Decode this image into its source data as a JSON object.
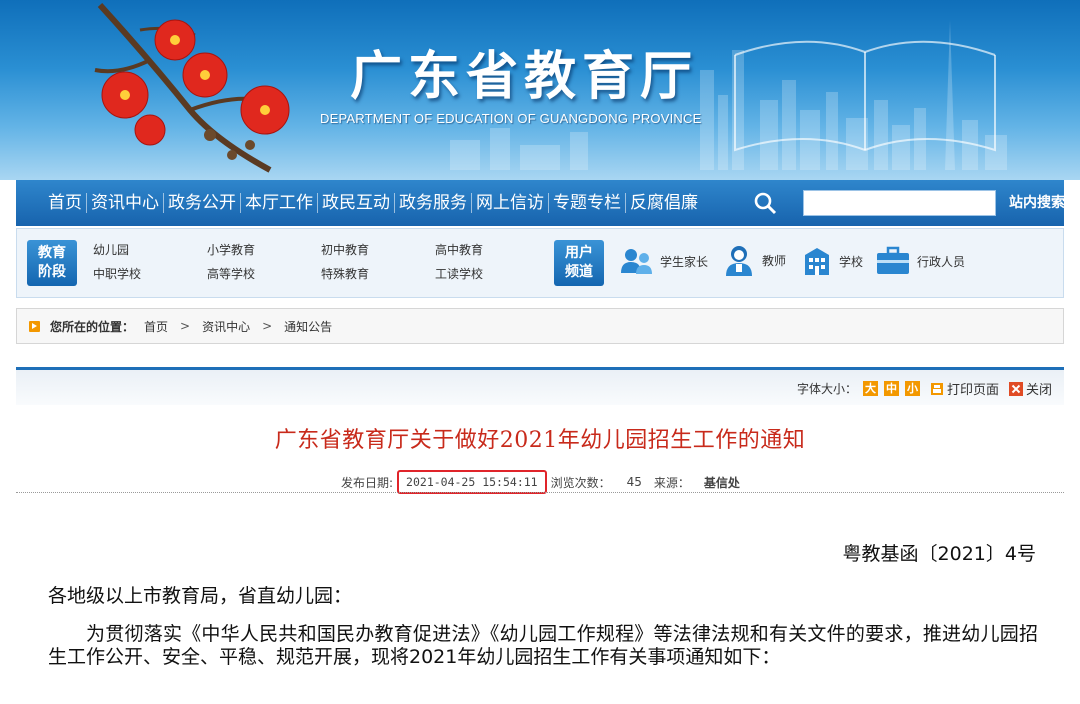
{
  "banner": {
    "title": "广东省教育厅",
    "subtitle": "DEPARTMENT OF EDUCATION OF GUANGDONG PROVINCE"
  },
  "nav": {
    "items": [
      "首页",
      "资讯中心",
      "政务公开",
      "本厅工作",
      "政民互动",
      "政务服务",
      "网上信访",
      "专题专栏",
      "反腐倡廉"
    ],
    "search_placeholder": "",
    "search_button": "站内搜索"
  },
  "stages": {
    "badge": [
      "教育",
      "阶段"
    ],
    "links": [
      "幼儿园",
      "中职学校",
      "小学教育",
      "高等学校",
      "初中教育",
      "特殊教育",
      "高中教育",
      "工读学校"
    ]
  },
  "users": {
    "badge": [
      "用户",
      "频道"
    ],
    "items": [
      {
        "label": "学生家长",
        "icon": "parents-icon"
      },
      {
        "label": "教师",
        "icon": "teacher-icon"
      },
      {
        "label": "学校",
        "icon": "school-icon"
      },
      {
        "label": "行政人员",
        "icon": "briefcase-icon"
      }
    ]
  },
  "breadcrumb": {
    "label": "您所在的位置：",
    "items": [
      "首页",
      "资讯中心",
      "通知公告"
    ],
    "separator": ">"
  },
  "tools": {
    "font_size_label": "字体大小：",
    "sizes": [
      "大",
      "中",
      "小"
    ],
    "print": "打印页面",
    "close": "关闭"
  },
  "article": {
    "title": "广东省教育厅关于做好2021年幼儿园招生工作的通知",
    "publish_label": "发布日期:",
    "publish_date": "2021-04-25 15:54:11",
    "views_label": "浏览次数：",
    "views": "45",
    "source_label": "来源：",
    "source": "基信处",
    "doc_number": "粤教基函〔2021〕4号",
    "salutation": "各地级以上市教育局，省直幼儿园：",
    "paragraph": "为贯彻落实《中华人民共和国民办教育促进法》《幼儿园工作规程》等法律法规和有关文件的要求，推进幼儿园招生工作公开、安全、平稳、规范开展，现将2021年幼儿园招生工作有关事项通知如下："
  },
  "colors": {
    "nav_blue": "#1763ad",
    "accent_orange": "#f39800",
    "title_red": "#c82a1b",
    "highlight_red": "#e0242a"
  }
}
